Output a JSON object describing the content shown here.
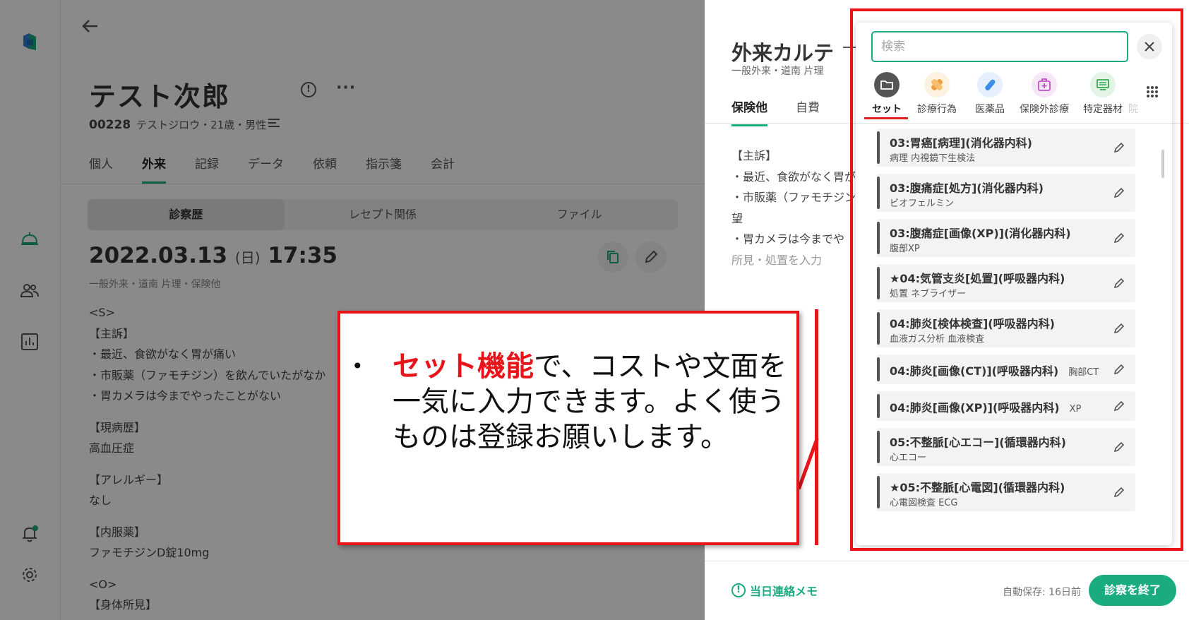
{
  "patient": {
    "name": "テスト次郎",
    "id": "00228",
    "info": "テストジロウ・21歳・男性",
    "tabs": [
      "個人",
      "外来",
      "記録",
      "データ",
      "依頼",
      "指示箋",
      "会計"
    ],
    "subtabs": [
      "診察歴",
      "レセプト関係",
      "ファイル"
    ],
    "visit_date": "2022.03.13",
    "visit_weekday": "(日)",
    "visit_time": "17:35",
    "visit_sub": "一般外来・道南 片理・保険他",
    "notes": [
      "<S>",
      "【主訴】",
      "・最近、食欲がなく胃が痛い",
      "・市販薬（ファモチジン）を飲んでいたがなか",
      "・胃カメラは今までやったことがない",
      "【現病歴】",
      "高血圧症",
      "【アレルギー】",
      "なし",
      "【内服薬】",
      "ファモチジンD錠10mg",
      "<O>",
      "【身体所見】"
    ]
  },
  "karte": {
    "title": "外来カルテ",
    "subtitle": "一般外来・道南 片理",
    "tabs": [
      "保険他",
      "自費"
    ],
    "notes": [
      "【主訴】",
      "・最近、食欲がなく胃が",
      "・市販薬（ファモチジン",
      "望",
      "・胃カメラは今までや"
    ],
    "findings_placeholder": "所見・処置を入力",
    "memo_label": "当日連絡メモ",
    "autosave": "自動保存: 16日前",
    "finish_label": "診察を終了"
  },
  "set_popup": {
    "search_placeholder": "検索",
    "categories": [
      {
        "label": "セット",
        "icon": "folder-icon",
        "color": "#555555"
      },
      {
        "label": "診療行為",
        "icon": "bandage-icon",
        "color": "#f0a040"
      },
      {
        "label": "医薬品",
        "icon": "pill-icon",
        "color": "#3a8ee6"
      },
      {
        "label": "保険外診療",
        "icon": "medkit-icon",
        "color": "#c050c8"
      },
      {
        "label": "特定器材",
        "icon": "monitor-icon",
        "color": "#30a850"
      },
      {
        "label": "院",
        "icon": "more-category-icon",
        "color": "#bbbbbb"
      }
    ],
    "items": [
      {
        "title": "03:胃癌[病理](消化器内科)",
        "sub": "病理 内視鏡下生検法",
        "inline": ""
      },
      {
        "title": "03:腹痛症[処方](消化器内科)",
        "sub": "ビオフェルミン",
        "inline": ""
      },
      {
        "title": "03:腹痛症[画像(XP)](消化器内科)",
        "sub": "腹部XP",
        "inline": ""
      },
      {
        "title": "★04:気管支炎[処置](呼吸器内科)",
        "sub": "処置 ネブライザー",
        "inline": ""
      },
      {
        "title": "04:肺炎[検体検査](呼吸器内科)",
        "sub": "血液ガス分析 血液検査",
        "inline": ""
      },
      {
        "title": "04:肺炎[画像(CT)](呼吸器内科)",
        "sub": "",
        "inline": "胸部CT"
      },
      {
        "title": "04:肺炎[画像(XP)](呼吸器内科)",
        "sub": "",
        "inline": "XP"
      },
      {
        "title": "05:不整脈[心エコー](循環器内科)",
        "sub": "心エコー",
        "inline": ""
      },
      {
        "title": "★05:不整脈[心電図](循環器内科)",
        "sub": "心電図検査 ECG",
        "inline": ""
      }
    ]
  },
  "annotation": {
    "bullet": "•",
    "highlight": "セット機能",
    "text": "で、コストや文面を一気に入力できます。よく使うものは登録お願いします。"
  },
  "colors": {
    "accent": "#1aab7f",
    "annotation": "#e8141a"
  }
}
